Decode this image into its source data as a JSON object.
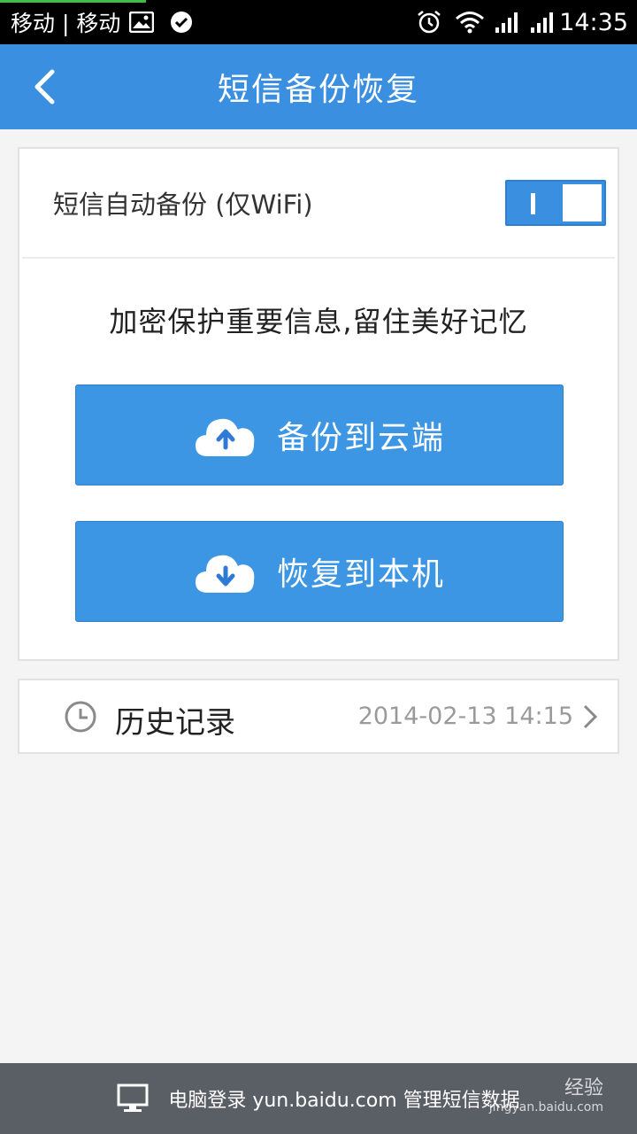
{
  "status_bar": {
    "carrier_text": "移动 | 移动",
    "time": "14:35",
    "icons": [
      "image-icon",
      "check-circle-icon",
      "alarm-icon",
      "wifi-icon",
      "signal-icon",
      "signal-icon"
    ]
  },
  "header": {
    "title": "短信备份恢复",
    "back_icon": "chevron-left-icon"
  },
  "auto_backup": {
    "label": "短信自动备份 (仅WiFi)",
    "enabled": true
  },
  "slogan": "加密保护重要信息,留住美好记忆",
  "actions": {
    "backup_label": "备份到云端",
    "restore_label": "恢复到本机"
  },
  "history": {
    "label": "历史记录",
    "last_time": "2014-02-13 14:15"
  },
  "footer": {
    "text": "电脑登录 yun.baidu.com 管理短信数据"
  },
  "watermark": {
    "brand": "经验",
    "url": "jingyan.baidu.com"
  },
  "colors": {
    "accent": "#3a8fe0",
    "button": "#3d96e4",
    "footer": "#5a5f66"
  }
}
